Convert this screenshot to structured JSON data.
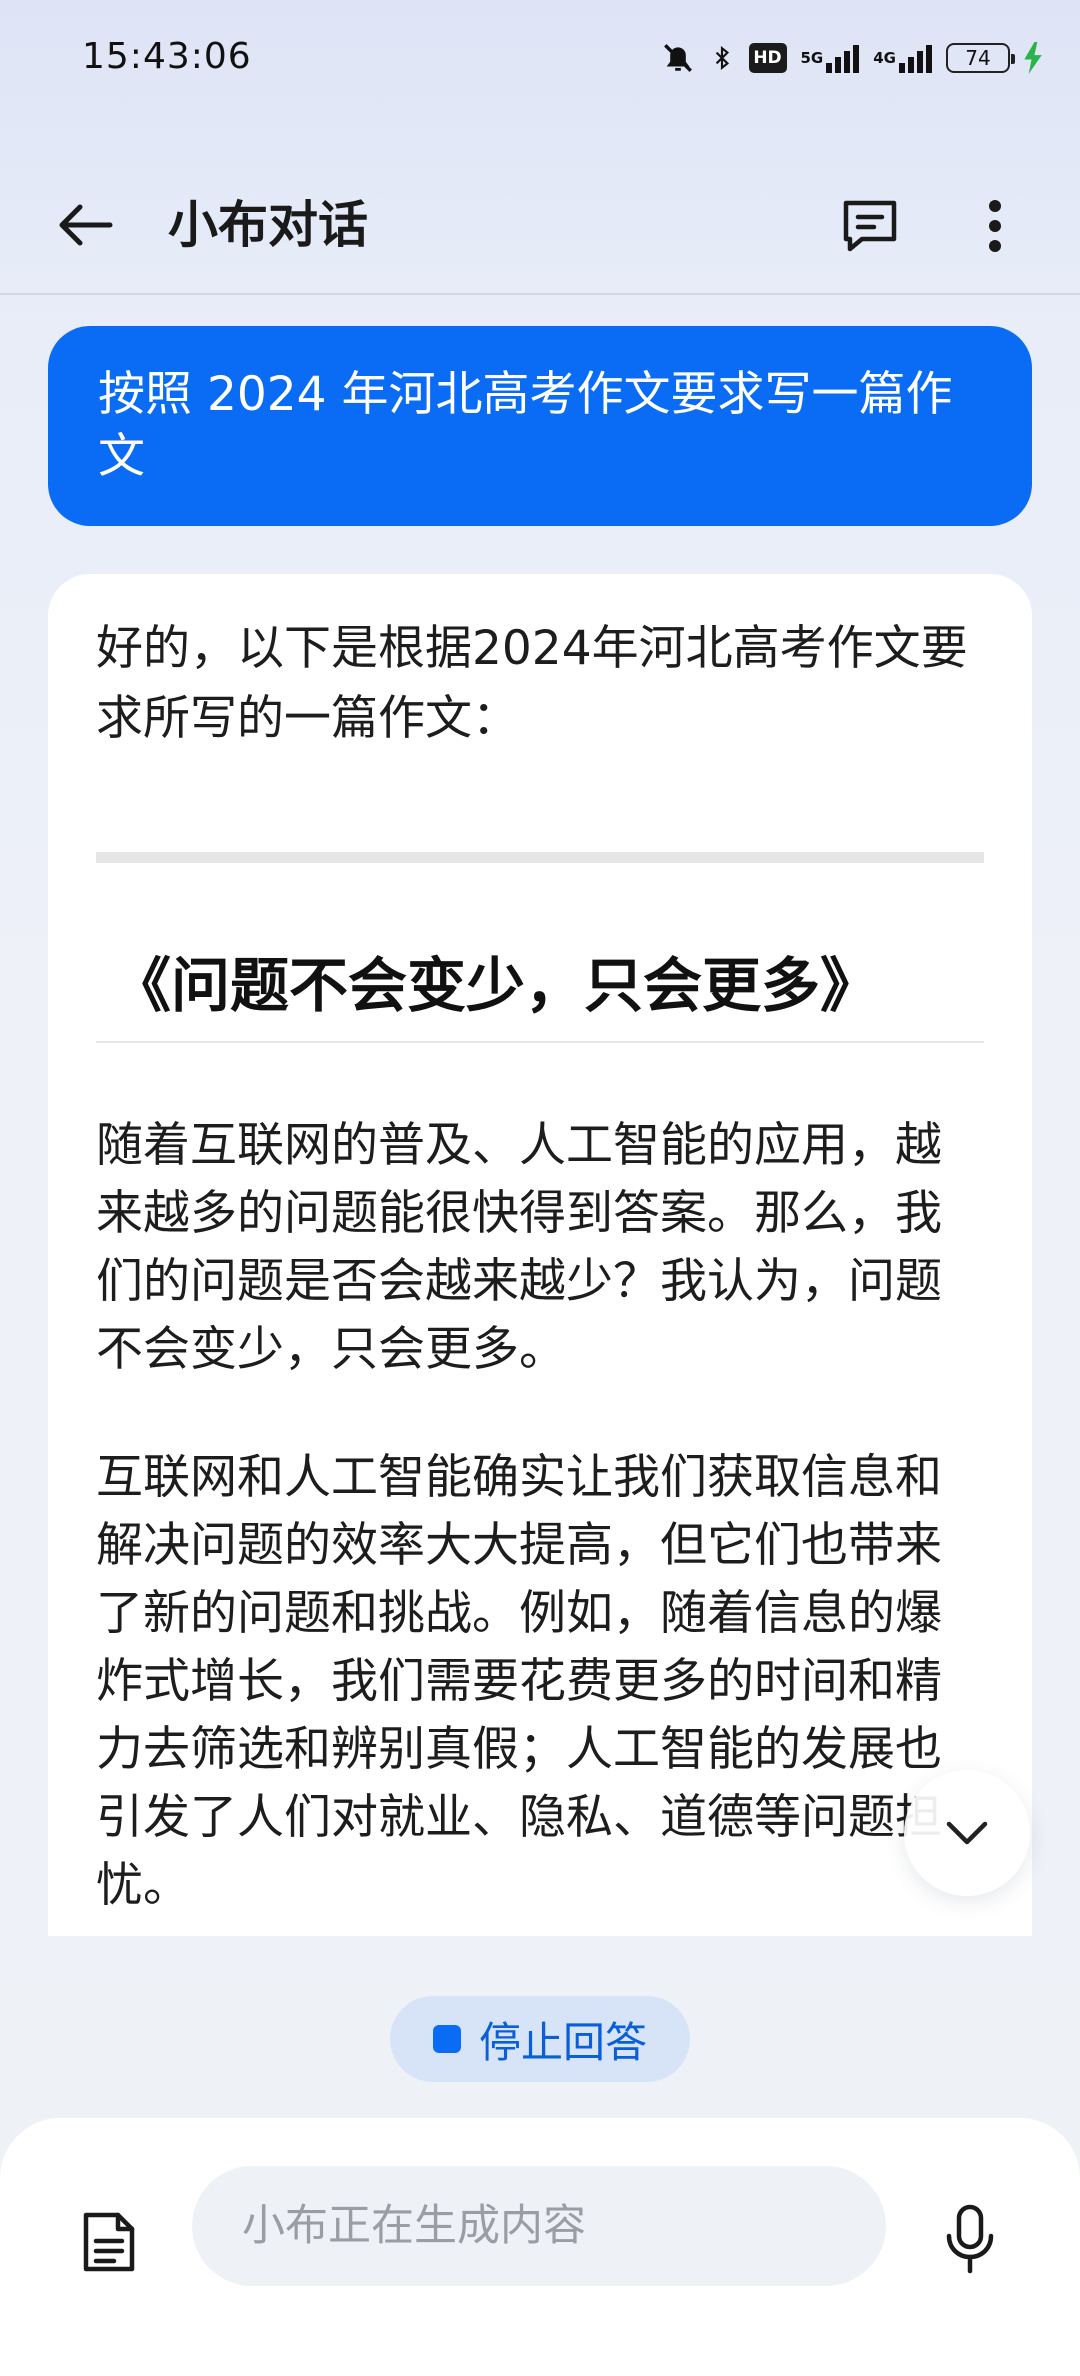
{
  "status_bar": {
    "time": "15:43:06",
    "hd_label": "HD",
    "network_1": "5G",
    "network_2": "4G",
    "battery": "74"
  },
  "app_bar": {
    "title": "小布对话"
  },
  "icons": {
    "back": "arrow-left-icon",
    "chat_list": "chat-list-icon",
    "more": "more-vertical-icon",
    "scroll_down": "chevron-down-icon",
    "document": "document-icon",
    "mic": "microphone-icon"
  },
  "colors": {
    "accent": "#0a6cf5",
    "stop_bg": "#d7e4f8",
    "input_bg": "#eef1f6"
  },
  "conversation": {
    "user_message": "按照 2024 年河北高考作文要求写一篇作文",
    "reply_intro": "好的，以下是根据2024年河北高考作文要求所写的一篇作文：",
    "essay_title": "《问题不会变少，只会更多》",
    "paragraphs": [
      "随着互联网的普及、人工智能的应用，越来越多的问题能很快得到答案。那么，我们的问题是否会越来越少？我认为，问题不会变少，只会更多。",
      "互联网和人工智能确实让我们获取信息和解决问题的效率大大提高，但它们也带来了新的问题和挑战。例如，随着信息的爆炸式增长，我们需要花费更多的时间和精力去筛选和辨别真假；人工智能的发展也引发了人们对就业、隐私、道德等问题担忧。"
    ]
  },
  "controls": {
    "stop_label": "停止回答"
  },
  "input": {
    "placeholder": "小布正在生成内容",
    "value": ""
  }
}
